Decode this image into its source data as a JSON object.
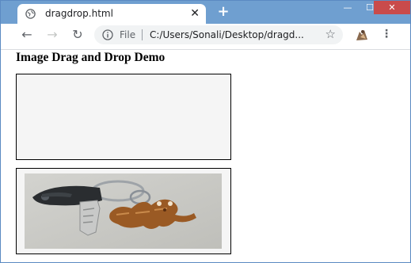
{
  "tab": {
    "title": "dragdrop.html",
    "close": "✕"
  },
  "newtab": "+",
  "window": {
    "minimize": "—",
    "maximize": "☐",
    "close": "✕"
  },
  "toolbar": {
    "back": "←",
    "forward": "→",
    "reload": "↻",
    "menu": "⋮"
  },
  "address": {
    "scheme": "File",
    "url": "C:/Users/Sonali/Desktop/dragd...",
    "star": "☆"
  },
  "icons": {
    "tab": "globe-icon",
    "info": "info-icon",
    "star": "star-icon",
    "profile": "profile-avatar",
    "menu": "more-vert-icon"
  },
  "page": {
    "heading": "Image Drag and Drop Demo"
  },
  "colors": {
    "titlebar": "#6f9fd0",
    "close_button": "#c94b4b",
    "box_fill": "#f5f5f5"
  }
}
